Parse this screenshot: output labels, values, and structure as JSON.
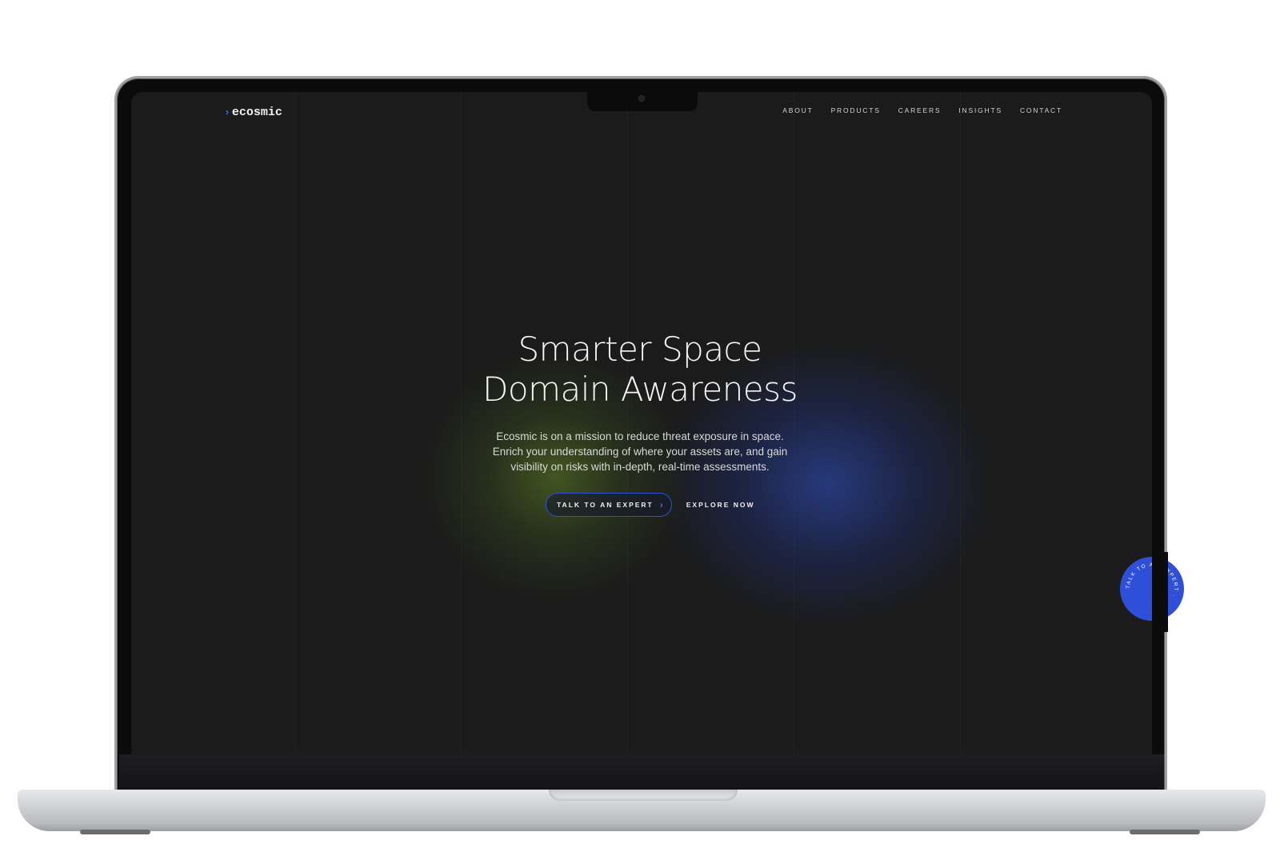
{
  "site": {
    "logo_text": "ecosmic",
    "logo_mark": "›",
    "nav": [
      {
        "label": "ABOUT"
      },
      {
        "label": "PRODUCTS"
      },
      {
        "label": "CAREERS"
      },
      {
        "label": "INSIGHTS"
      },
      {
        "label": "CONTACT"
      }
    ]
  },
  "hero": {
    "title_line1": "Smarter Space",
    "title_line2": "Domain Awareness",
    "desc_line1": "Ecosmic is on a mission to reduce threat exposure in space.",
    "desc_line2": "Enrich your understanding of where your assets are, and gain",
    "desc_line3": "visibility on risks with in-depth, real-time assessments.",
    "primary_cta": "TALK TO AN EXPERT",
    "primary_cta_icon": "chevron-right-icon",
    "secondary_cta": "EXPLORE NOW"
  },
  "floating_badge": {
    "text": "TALK TO AN EXPERT ."
  },
  "colors": {
    "accent": "#2f4fd8",
    "background": "#1b1b1b",
    "text": "#f4f4f4"
  }
}
